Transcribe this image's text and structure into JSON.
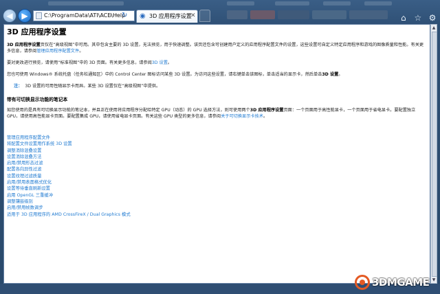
{
  "browser": {
    "address_url": "C:\\ProgramData\\ATI\\ACE\\Help",
    "tab_title": "3D 应用程序设置",
    "icons": [
      "back-arrow-icon",
      "forward-arrow-icon",
      "search-icon",
      "refresh-icon",
      "home-icon",
      "star-icon",
      "gear-icon"
    ]
  },
  "page": {
    "title": "3D 应用程序设置",
    "intro_bold": "3D 应用程序设置",
    "intro_text": "页仅在“高级视图”中可用。其中包含主要的 3D 设置，无法预览，用于快速调整。该页还包含可创建用户定义的应用程序配置文件的设置，这些设置可自定义特定应用程序和游戏的图像质量和性能。有关更多信息，请参阅",
    "intro_link": "管理应用程序配置文件",
    "intro_end": "。",
    "para2_text": "要对更改进行预览，请使用“标准视图”中的 3D 页面。有关更多信息，请参阅",
    "para2_link": "3D 设置",
    "para2_end": "。",
    "para3_text": "您也可使用 Windows® 系统托盘（任务栏通知区）中的 Control Center 图标访问某些 3D 设置。为访问这些设置，请右键单击该图标，单击适当的显示卡，然后单击",
    "para3_bold": "3D 设置",
    "para3_end": "。",
    "note_label": "注：",
    "note_text": "3D 设置的可用性随显示卡而异。某些 3D 设置仅在“高级视图”中提供。",
    "section_heading": "带有可切换显示功能的笔记本",
    "section_text_a": "如您使用的是具有可切换显示功能的笔记本，并且正在使用将应用程序分配给特定 GPU（动态）的 GPU 选择方法，则可使用两个",
    "section_bold": "3D 应用程序设置",
    "section_text_b": "页面：一个页面用于高性能显卡，一个页面用于省电显卡。要配置独立 GPU，请使用高性能显卡页面。要配置集成 GPU，请使用省电显卡页面。有关这些 GPU 类型的更多信息，请参阅",
    "section_link": "关于可切换显示卡技术",
    "section_end": "。",
    "links": [
      "管理应用程序配置文件",
      "将配置文件设置用作系统 3D 设置",
      "调整消除混叠设置",
      "设置消除混叠方法",
      "启用/禁用形态过滤",
      "配置各向异性过滤",
      "设置纹理过滤质量",
      "启用/禁用表面格式优化",
      "设置等待垂直刷新设置",
      "启用 OpenGL 三重缓冲",
      "调整镶嵌级别",
      "启用/禁用帧数调步",
      "适用于 3D 应用程序的 AMD CrossFireX / Dual Graphics 模式"
    ]
  },
  "watermark": {
    "text": "3DMGAME"
  }
}
